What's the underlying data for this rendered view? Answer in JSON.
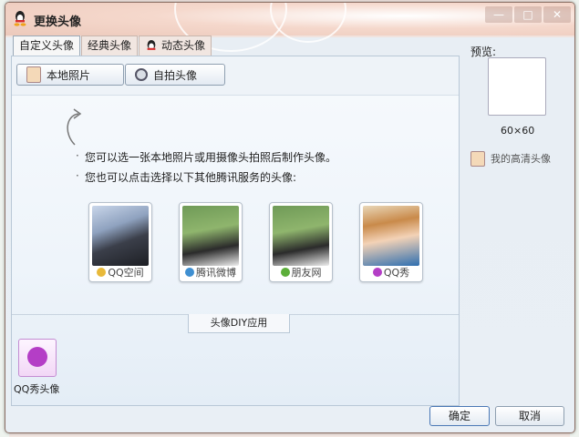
{
  "window": {
    "title": "更换头像",
    "controls": [
      "—",
      "□",
      "✕"
    ]
  },
  "tabs": [
    {
      "label": "自定义头像",
      "active": true
    },
    {
      "label": "经典头像",
      "active": false
    },
    {
      "label": "动态头像",
      "active": false
    }
  ],
  "toolbar": {
    "local_photo_label": "本地照片",
    "camera_label": "自拍头像"
  },
  "tips": [
    "您可以选一张本地照片或用摄像头拍照后制作头像。",
    "您也可以点击选择以下其他腾讯服务的头像:"
  ],
  "avatars": [
    {
      "label": "QQ空间",
      "icon": "star-icon",
      "color": "#e8b93a"
    },
    {
      "label": "腾讯微博",
      "icon": "weibo-icon",
      "color": "#3f8fd1"
    },
    {
      "label": "朋友网",
      "icon": "clover-icon",
      "color": "#5cae3a"
    },
    {
      "label": "QQ秀",
      "icon": "qqshow-icon",
      "color": "#b43ec6"
    }
  ],
  "diy": {
    "tab_label": "头像DIY应用",
    "apps": [
      {
        "label": "QQ秀头像",
        "icon": "qqshow-icon"
      }
    ]
  },
  "preview": {
    "label": "预览:",
    "size": "60×60",
    "hd_link": "我的高清头像"
  },
  "footer": {
    "ok_label": "确定",
    "cancel_label": "取消"
  },
  "colors": {
    "accent_blue": "#4a78b5",
    "panel": "#eef4fa"
  }
}
